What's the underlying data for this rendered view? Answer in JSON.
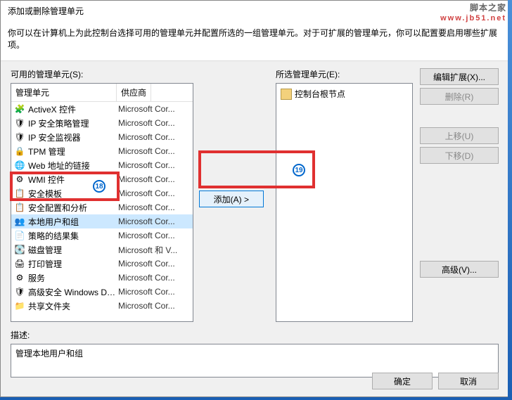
{
  "dialog": {
    "title": "添加或删除管理单元",
    "description": "你可以在计算机上为此控制台选择可用的管理单元并配置所选的一组管理单元。对于可扩展的管理单元，你可以配置要启用哪些扩展项。"
  },
  "available": {
    "label": "可用的管理单元(S):",
    "col_snapin": "管理单元",
    "col_vendor": "供应商",
    "items": [
      {
        "name": "ActiveX 控件",
        "vendor": "Microsoft Cor...",
        "icon": "🧩"
      },
      {
        "name": "IP 安全策略管理",
        "vendor": "Microsoft Cor...",
        "icon": "🛡"
      },
      {
        "name": "IP 安全监视器",
        "vendor": "Microsoft Cor...",
        "icon": "🛡"
      },
      {
        "name": "TPM 管理",
        "vendor": "Microsoft Cor...",
        "icon": "🔒"
      },
      {
        "name": "Web 地址的链接",
        "vendor": "Microsoft Cor...",
        "icon": "🌐"
      },
      {
        "name": "WMI 控件",
        "vendor": "Microsoft Cor...",
        "icon": "⚙"
      },
      {
        "name": "安全模板",
        "vendor": "Microsoft Cor...",
        "icon": "📋"
      },
      {
        "name": "安全配置和分析",
        "vendor": "Microsoft Cor...",
        "icon": "📋"
      },
      {
        "name": "本地用户和组",
        "vendor": "Microsoft Cor...",
        "icon": "👥",
        "selected": true
      },
      {
        "name": "策略的结果集",
        "vendor": "Microsoft Cor...",
        "icon": "📄"
      },
      {
        "name": "磁盘管理",
        "vendor": "Microsoft 和 V...",
        "icon": "💽"
      },
      {
        "name": "打印管理",
        "vendor": "Microsoft Cor...",
        "icon": "🖨"
      },
      {
        "name": "服务",
        "vendor": "Microsoft Cor...",
        "icon": "⚙"
      },
      {
        "name": "高级安全 Windows De...",
        "vendor": "Microsoft Cor...",
        "icon": "🛡"
      },
      {
        "name": "共享文件夹",
        "vendor": "Microsoft Cor...",
        "icon": "📁"
      }
    ]
  },
  "selected": {
    "label": "所选管理单元(E):",
    "root": "控制台根节点"
  },
  "buttons": {
    "add": "添加(A) >",
    "edit_ext": "编辑扩展(X)...",
    "remove": "删除(R)",
    "move_up": "上移(U)",
    "move_down": "下移(D)",
    "advanced": "高级(V)...",
    "ok": "确定",
    "cancel": "取消"
  },
  "description_panel": {
    "label": "描述:",
    "text": "管理本地用户和组"
  },
  "watermark": {
    "name": "脚本之家",
    "url": "www.jb51.net"
  },
  "annotations": {
    "b1": "18",
    "b2": "19"
  }
}
